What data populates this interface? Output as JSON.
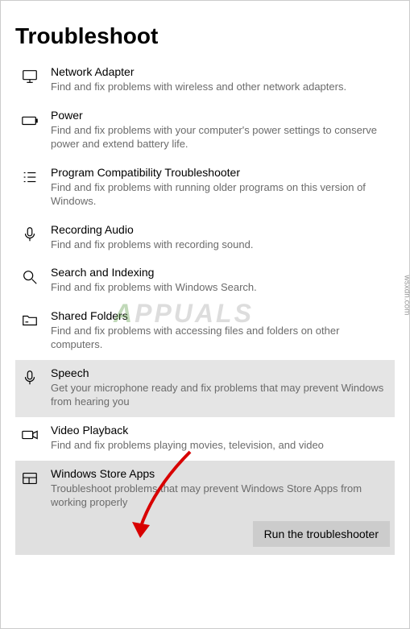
{
  "heading": "Troubleshoot",
  "items": [
    {
      "title": "Network Adapter",
      "desc": "Find and fix problems with wireless and other network adapters.",
      "icon": "monitor",
      "state": "normal"
    },
    {
      "title": "Power",
      "desc": "Find and fix problems with your computer's power settings to conserve power and extend battery life.",
      "icon": "battery",
      "state": "normal"
    },
    {
      "title": "Program Compatibility Troubleshooter",
      "desc": "Find and fix problems with running older programs on this version of Windows.",
      "icon": "list",
      "state": "normal"
    },
    {
      "title": "Recording Audio",
      "desc": "Find and fix problems with recording sound.",
      "icon": "mic",
      "state": "normal"
    },
    {
      "title": "Search and Indexing",
      "desc": "Find and fix problems with Windows Search.",
      "icon": "search",
      "state": "normal"
    },
    {
      "title": "Shared Folders",
      "desc": "Find and fix problems with accessing files and folders on other computers.",
      "icon": "folder",
      "state": "normal"
    },
    {
      "title": "Speech",
      "desc": "Get your microphone ready and fix problems that may prevent Windows from hearing you",
      "icon": "mic",
      "state": "selected"
    },
    {
      "title": "Video Playback",
      "desc": "Find and fix problems playing movies, television, and video",
      "icon": "video",
      "state": "normal"
    },
    {
      "title": "Windows Store Apps",
      "desc": "Troubleshoot problems that may prevent Windows Store Apps from working properly",
      "icon": "store",
      "state": "expanded"
    }
  ],
  "run_button": "Run the troubleshooter",
  "watermark": "APPUALS",
  "credit": "wsxdn.com"
}
